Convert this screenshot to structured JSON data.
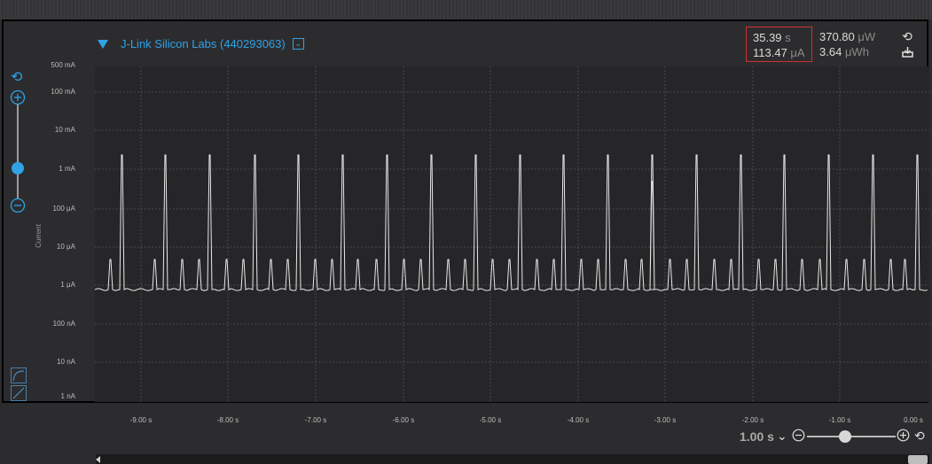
{
  "device": {
    "label": "J-Link Silicon Labs (440293063)"
  },
  "stats": {
    "time_value": "35.39",
    "time_unit": "s",
    "current_value": "113.47",
    "current_unit": "μA",
    "power_value": "370.80",
    "power_unit": "μW",
    "energy_value": "3.64",
    "energy_unit": "μWh"
  },
  "yaxis": {
    "title": "Current",
    "ticks": [
      "500 mA",
      "100 mA",
      "10 mA",
      "1 mA",
      "100 μA",
      "10 μA",
      "1 μA",
      "100 nA",
      "10 nA",
      "1 nA"
    ]
  },
  "xaxis": {
    "ticks": [
      "-9.00 s",
      "-8.00 s",
      "-7.00 s",
      "-6.00 s",
      "-5.00 s",
      "-4.00 s",
      "-3.00 s",
      "-2.00 s",
      "-1.00 s",
      "0.00 s"
    ]
  },
  "zoom": {
    "value": "1.00 s"
  },
  "colors": {
    "accent": "#2fa3e6",
    "highlight": "#d03030",
    "trace": "#e8e8e8",
    "plot_bg": "#262628"
  },
  "icons": {
    "refresh": "refresh-icon",
    "save": "save-icon",
    "zoom_in": "zoom-in-icon",
    "zoom_out": "zoom-out-icon",
    "chevron": "chevron-down-icon"
  }
}
